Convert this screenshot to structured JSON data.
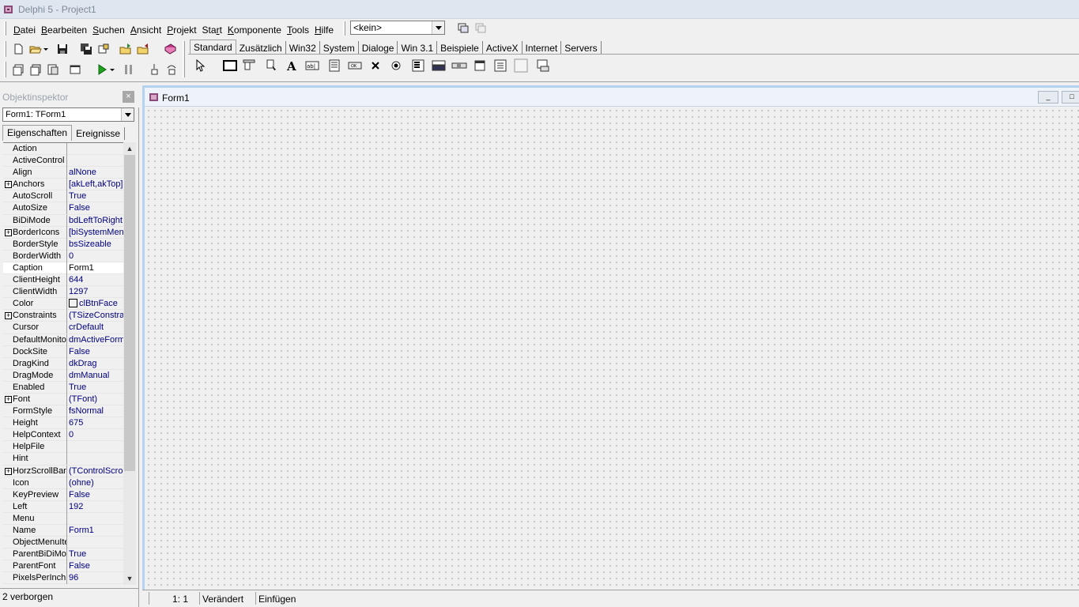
{
  "window": {
    "title": "Delphi 5 - Project1"
  },
  "menu": [
    {
      "label": "Datei",
      "ul": "D",
      "rest": "atei"
    },
    {
      "label": "Bearbeiten",
      "ul": "B",
      "rest": "earbeiten"
    },
    {
      "label": "Suchen",
      "ul": "S",
      "rest": "uchen"
    },
    {
      "label": "Ansicht",
      "ul": "A",
      "rest": "nsicht"
    },
    {
      "label": "Projekt",
      "ul": "P",
      "rest": "rojekt"
    },
    {
      "label": "Start",
      "pre": "Sta",
      "ul": "r",
      "rest": "t"
    },
    {
      "label": "Komponente",
      "ul": "K",
      "rest": "omponente"
    },
    {
      "label": "Tools",
      "ul": "T",
      "rest": "ools"
    },
    {
      "label": "Hilfe",
      "ul": "H",
      "rest": "ilfe"
    }
  ],
  "desktop_combo": {
    "value": "<kein>"
  },
  "palette_tabs": [
    "Standard",
    "Zusätzlich",
    "Win32",
    "System",
    "Dialoge",
    "Win 3.1",
    "Beispiele",
    "ActiveX",
    "Internet",
    "Servers"
  ],
  "palette_active": "Standard",
  "inspector": {
    "title": "Objektinspektor",
    "close": "×",
    "object_combo": "Form1: TForm1",
    "tabs": [
      "Eigenschaften",
      "Ereignisse"
    ],
    "status": "2 verborgen",
    "properties": [
      {
        "name": "Action",
        "value": ""
      },
      {
        "name": "ActiveControl",
        "value": ""
      },
      {
        "name": "Align",
        "value": "alNone"
      },
      {
        "name": "Anchors",
        "value": "[akLeft,akTop]",
        "expand": true
      },
      {
        "name": "AutoScroll",
        "value": "True"
      },
      {
        "name": "AutoSize",
        "value": "False"
      },
      {
        "name": "BiDiMode",
        "value": "bdLeftToRight"
      },
      {
        "name": "BorderIcons",
        "value": "[biSystemMenu",
        "expand": true
      },
      {
        "name": "BorderStyle",
        "value": "bsSizeable"
      },
      {
        "name": "BorderWidth",
        "value": "0"
      },
      {
        "name": "Caption",
        "value": "Form1",
        "selected": true
      },
      {
        "name": "ClientHeight",
        "value": "644"
      },
      {
        "name": "ClientWidth",
        "value": "1297"
      },
      {
        "name": "Color",
        "value": "clBtnFace",
        "swatch": true
      },
      {
        "name": "Constraints",
        "value": "(TSizeConstrain",
        "expand": true
      },
      {
        "name": "Cursor",
        "value": "crDefault"
      },
      {
        "name": "DefaultMonitor",
        "value": "dmActiveForm"
      },
      {
        "name": "DockSite",
        "value": "False"
      },
      {
        "name": "DragKind",
        "value": "dkDrag"
      },
      {
        "name": "DragMode",
        "value": "dmManual"
      },
      {
        "name": "Enabled",
        "value": "True"
      },
      {
        "name": "Font",
        "value": "(TFont)",
        "expand": true
      },
      {
        "name": "FormStyle",
        "value": "fsNormal"
      },
      {
        "name": "Height",
        "value": "675"
      },
      {
        "name": "HelpContext",
        "value": "0"
      },
      {
        "name": "HelpFile",
        "value": ""
      },
      {
        "name": "Hint",
        "value": ""
      },
      {
        "name": "HorzScrollBar",
        "value": "(TControlScrollB",
        "expand": true
      },
      {
        "name": "Icon",
        "value": "(ohne)"
      },
      {
        "name": "KeyPreview",
        "value": "False"
      },
      {
        "name": "Left",
        "value": "192"
      },
      {
        "name": "Menu",
        "value": ""
      },
      {
        "name": "Name",
        "value": "Form1"
      },
      {
        "name": "ObjectMenuItem",
        "value": ""
      },
      {
        "name": "ParentBiDiMode",
        "value": "True"
      },
      {
        "name": "ParentFont",
        "value": "False"
      },
      {
        "name": "PixelsPerInch",
        "value": "96"
      }
    ]
  },
  "form": {
    "caption": "Form1",
    "min": "_",
    "max": "□"
  },
  "editor_status": {
    "position": "1:   1",
    "modified": "Verändert",
    "mode": "Einfügen"
  }
}
